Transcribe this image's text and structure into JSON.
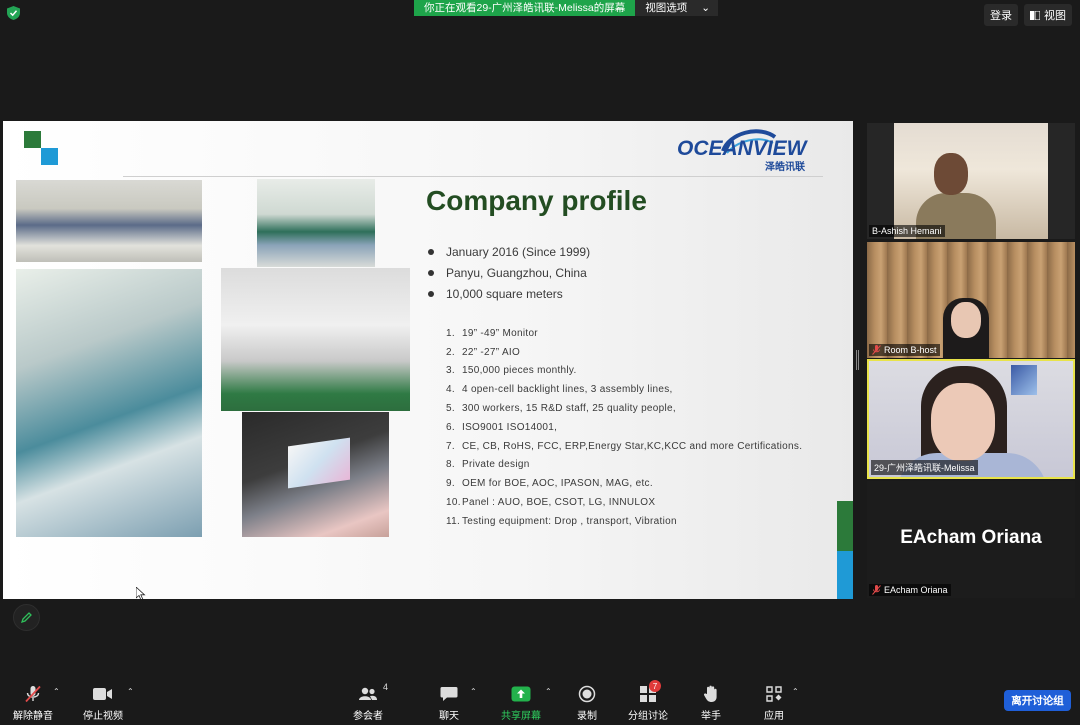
{
  "top": {
    "share_message": "你正在观看29-广州泽皓讯联-Melissa的屏幕",
    "view_options": "视图选项",
    "login": "登录",
    "view": "视图"
  },
  "slide": {
    "brand_name": "OCEANVIEW",
    "brand_cn": "泽皓讯联",
    "title": "Company profile",
    "bullets": [
      "January 2016 (Since 1999)",
      "Panyu, Guangzhou, China",
      "10,000 square meters"
    ],
    "items": [
      {
        "num": "1.",
        "text": "19” -49” Monitor"
      },
      {
        "num": "2.",
        "text": "22” -27”  AIO"
      },
      {
        "num": "3.",
        "text": "150,000 pieces monthly."
      },
      {
        "num": "4.",
        "text": "4 open-cell backlight lines, 3 assembly lines,"
      },
      {
        "num": "5.",
        "text": "300 workers,  15 R&D staff, 25 quality people,"
      },
      {
        "num": "6.",
        "text": "ISO9001 ISO14001,"
      },
      {
        "num": "7.",
        "text": "CE, CB, RoHS, FCC, ERP,Energy Star,KC,KCC and more Certifications."
      },
      {
        "num": "8.",
        "text": "Private design"
      },
      {
        "num": "9.",
        "text": "OEM for BOE, AOC, IPASON, MAG, etc."
      },
      {
        "num": "10.",
        "text": "Panel : AUO, BOE, CSOT, LG, INNULOX"
      },
      {
        "num": "11.",
        "text": "Testing equipment: Drop , transport, Vibration"
      }
    ]
  },
  "participants": [
    {
      "name": "B-Ashish Hemani",
      "muted": false
    },
    {
      "name": "Room B-host",
      "muted": true
    },
    {
      "name": "29-广州泽皓讯联-Melissa",
      "muted": false
    },
    {
      "name": "EAcham Oriana",
      "muted": true,
      "display": "EAcham Oriana"
    }
  ],
  "toolbar": {
    "unmute": "解除静音",
    "start_video": "停止视频",
    "participants": "参会者",
    "participants_count": "4",
    "chat": "聊天",
    "share": "共享屏幕",
    "record": "录制",
    "breakout": "分组讨论",
    "breakout_badge": "7",
    "raise_hand": "举手",
    "apps": "应用",
    "leave": "离开讨论组"
  },
  "colors": {
    "share_green": "#1ea44a",
    "title_green": "#234d22",
    "brand_blue": "#1e4a9a",
    "leave_blue": "#1f5fd8",
    "active_speaker": "#e8e34a"
  }
}
